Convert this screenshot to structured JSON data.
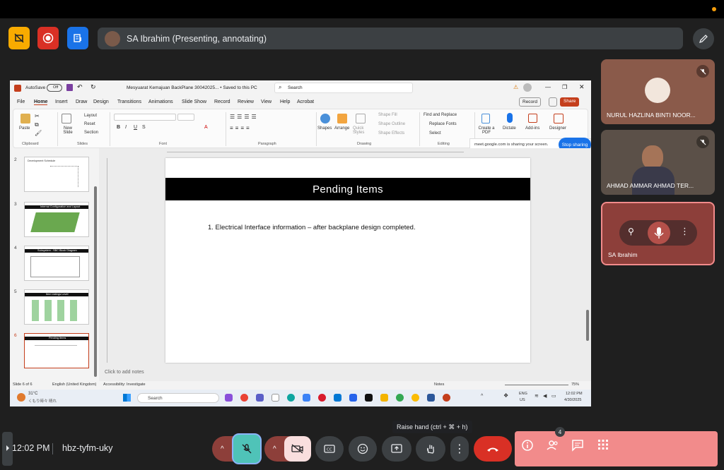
{
  "meeting": {
    "presenting_text": "SA Ibrahim (Presenting, annotating)",
    "time": "12:02 PM",
    "code": "hbz-tyfm-uky",
    "tooltip": "Raise hand (ctrl + ⌘ + h)",
    "people_count": "4",
    "accent": "#f28b8b",
    "mic_active_color": "#4fc3b8"
  },
  "participants": [
    {
      "name": "NURUL HAZLINA BINTI NOOR...",
      "muted": true
    },
    {
      "name": "AHMAD AMMAR AHMAD TER...",
      "muted": true
    },
    {
      "name": "SA Ibrahim",
      "muted": false
    }
  ],
  "ppt": {
    "autosave_label": "AutoSave",
    "autosave_state": "Off",
    "doc_title": "Mesyuarat Kemajuan BackPlane 30042025... • Saved to this PC",
    "search_placeholder": "Search",
    "record_label": "Record",
    "share_label": "Share",
    "menus": [
      "File",
      "Home",
      "Insert",
      "Draw",
      "Design",
      "Transitions",
      "Animations",
      "Slide Show",
      "Record",
      "Review",
      "View",
      "Help",
      "Acrobat"
    ],
    "ribbon": {
      "paste": "Paste",
      "clipboard": "Clipboard",
      "new_slide": "New Slide",
      "layout": "Layout",
      "reset": "Reset",
      "section": "Section",
      "slides": "Slides",
      "font": "Font",
      "paragraph": "Paragraph",
      "shapes": "Shapes",
      "arrange": "Arrange",
      "quick_styles": "Quick Styles",
      "shape_fill": "Shape Fill",
      "shape_outline": "Shape Outline",
      "shape_effects": "Shape Effects",
      "drawing": "Drawing",
      "find_replace": "Find and Replace",
      "replace_fonts": "Replace Fonts",
      "select": "Select",
      "editing": "Editing",
      "create_pdf": "Create a PDF",
      "dictate": "Dictate",
      "addins": "Add-ins",
      "designer": "Designer"
    },
    "share_notice": "meet.google.com is sharing your screen.",
    "stop_sharing": "Stop sharing",
    "thumbnails": [
      {
        "num": "2",
        "caption": "Development Schedule"
      },
      {
        "num": "3",
        "caption": "Internal Configuration and Layout"
      },
      {
        "num": "4",
        "caption": "Subsystem - SBC Block Diagram"
      },
      {
        "num": "5",
        "caption": "Item Listings Level"
      },
      {
        "num": "6",
        "caption": "Pending Items"
      }
    ],
    "slide_title": "Pending Items",
    "slide_item": "1. Electrical Interface information – after backplane design completed.",
    "notes_placeholder": "Click to add notes",
    "status_slide": "Slide 6 of 6",
    "status_lang": "English (United Kingdom)",
    "status_access": "Accessibility: Investigate",
    "status_notes": "Notes",
    "zoom": "75%"
  },
  "taskbar": {
    "weather_temp": "31°C",
    "weather_desc": "くもり時々 晴れ",
    "search": "Search",
    "lang": "ENG",
    "region": "US",
    "time": "12:02 PM",
    "date": "4/30/2025"
  }
}
